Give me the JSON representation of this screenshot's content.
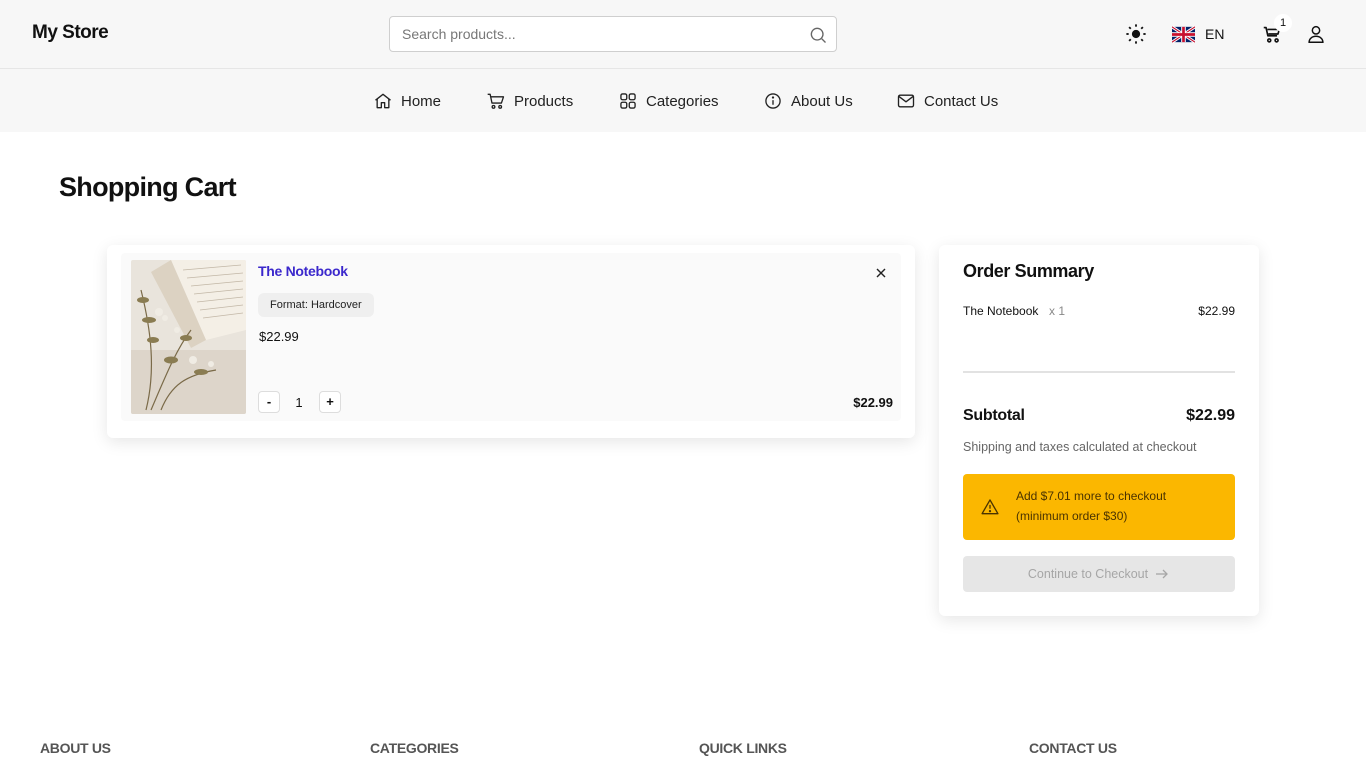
{
  "header": {
    "logo": "My Store",
    "search_placeholder": "Search products...",
    "language": "EN",
    "cart_count": "1"
  },
  "nav": {
    "items": [
      {
        "label": "Home",
        "icon": "home-icon"
      },
      {
        "label": "Products",
        "icon": "cart-icon"
      },
      {
        "label": "Categories",
        "icon": "grid-icon"
      },
      {
        "label": "About Us",
        "icon": "info-icon"
      },
      {
        "label": "Contact Us",
        "icon": "mail-icon"
      }
    ]
  },
  "page": {
    "title": "Shopping Cart"
  },
  "cart": {
    "items": [
      {
        "title": "The Notebook",
        "format": "Format: Hardcover",
        "price": "$22.99",
        "quantity": "1",
        "decrement_label": "-",
        "increment_label": "+",
        "line_total": "$22.99"
      }
    ]
  },
  "summary": {
    "title": "Order Summary",
    "line_name": "The Notebook",
    "line_qty": "x 1",
    "line_price": "$22.99",
    "subtotal_label": "Subtotal",
    "subtotal_value": "$22.99",
    "shipping_note": "Shipping and taxes calculated at checkout",
    "alert_text": "Add $7.01 more to checkout (minimum order $30)",
    "checkout_label": "Continue to Checkout"
  },
  "footer": {
    "headings": [
      "ABOUT US",
      "CATEGORIES",
      "QUICK LINKS",
      "CONTACT US"
    ]
  },
  "colors": {
    "accent_link": "#3b28cc",
    "alert_bg": "#fbb700",
    "header_bg": "#f7f7f7"
  }
}
